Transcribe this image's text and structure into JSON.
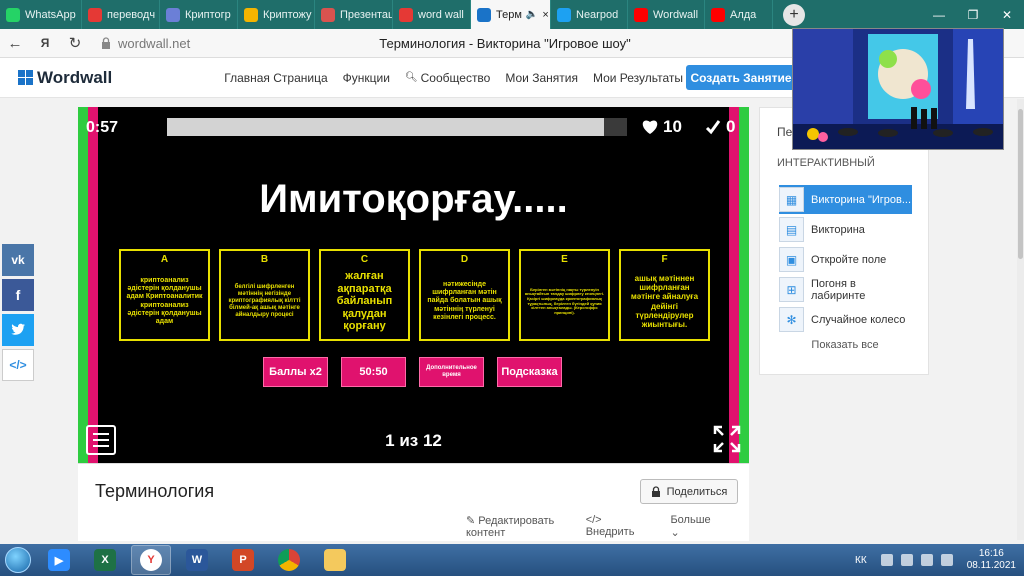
{
  "browser": {
    "tabs": [
      {
        "label": "WhatsApp",
        "icon": "whatsapp-icon",
        "color": "#25d366"
      },
      {
        "label": "переводч",
        "icon": "yandex-icon",
        "color": "#e53935"
      },
      {
        "label": "Криптогр",
        "icon": "document-icon",
        "color": "#6b7fd7"
      },
      {
        "label": "Криптожу",
        "icon": "image-icon",
        "color": "#f4b400"
      },
      {
        "label": "Презентац",
        "icon": "slides-icon",
        "color": "#d9534f"
      },
      {
        "label": "word wall",
        "icon": "yandex-icon",
        "color": "#e53935"
      },
      {
        "label": "Терм",
        "icon": "wordwall-icon",
        "color": "#1a73c8",
        "active": true
      },
      {
        "label": "Nearpod",
        "icon": "nearpod-icon",
        "color": "#1da1f2"
      },
      {
        "label": "Wordwall",
        "icon": "youtube-icon",
        "color": "#ff0000"
      },
      {
        "label": "Алда",
        "icon": "youtube-icon",
        "color": "#ff0000"
      }
    ],
    "url": "wordwall.net",
    "page_title": "Терминология - Викторина \"Игровое шоу\""
  },
  "header": {
    "logo": "Wordwall",
    "nav": [
      "Главная Страница",
      "Функции",
      "Сообщество",
      "Мои Занятия",
      "Мои Результаты"
    ],
    "create_button": "Создать Занятие"
  },
  "game": {
    "timer": "0:57",
    "progress": 0.95,
    "lives": "10",
    "score": "0",
    "question": "Имитоқорғау.....",
    "answers": [
      {
        "letter": "A",
        "text": "криптоанализ әдістерін қолданушы адам Криптоаналитик криптоанализ әдістерін қолданушы адам",
        "size": 7
      },
      {
        "letter": "B",
        "text": "белгілі шифрленген мәтіннің негізінде криптографиялық кілтті білмей-ақ ашық мәтінге айналдыру процесі",
        "size": 6
      },
      {
        "letter": "C",
        "text": "жалған ақпаратқа байланып қалудан қорғану",
        "size": 11
      },
      {
        "letter": "D",
        "text": "нәтижесінде шифрланған мәтін пайда болатын ашық мәтіннің түрленуі кезінлегі процесс.",
        "size": 7
      },
      {
        "letter": "E",
        "text": "Берілген мәтіннің нақты түрленуін анықтайтын тандау шифрлеу кезеңнегі. Қазіргі шифрлауда криптографиялық тұрақтылық, берілген бүгіндей құпия кілттен анықталады. (Керсгоффс принципі).",
        "size": 4
      },
      {
        "letter": "F",
        "text": "ашық мәтіннен шифрланған мәтінге айналуға дейінгі түрлендірулер жиынтығы.",
        "size": 8
      }
    ],
    "powerups": [
      {
        "label": "Баллы x2",
        "size": 11
      },
      {
        "label": "50:50",
        "size": 11
      },
      {
        "label": "Дополнительное время",
        "size": 6
      },
      {
        "label": "Подсказка",
        "size": 11
      }
    ],
    "counter": "1 из 12"
  },
  "activity": {
    "title": "Терминология",
    "share_button": "Поделиться",
    "actions": [
      "Редактировать контент",
      "Внедрить",
      "Больше"
    ]
  },
  "sidebar": {
    "stub": "Пе",
    "heading": "ИНТЕРАКТИВНЫЙ",
    "templates": [
      {
        "label": "Викторина \"Игров...",
        "selected": true
      },
      {
        "label": "Викторина"
      },
      {
        "label": "Откройте поле"
      },
      {
        "label": "Погоня в лабиринте"
      },
      {
        "label": "Случайное колесо"
      }
    ],
    "show_all": "Показать все"
  },
  "taskbar": {
    "language": "КК",
    "time": "16:16",
    "date": "08.11.2021"
  }
}
